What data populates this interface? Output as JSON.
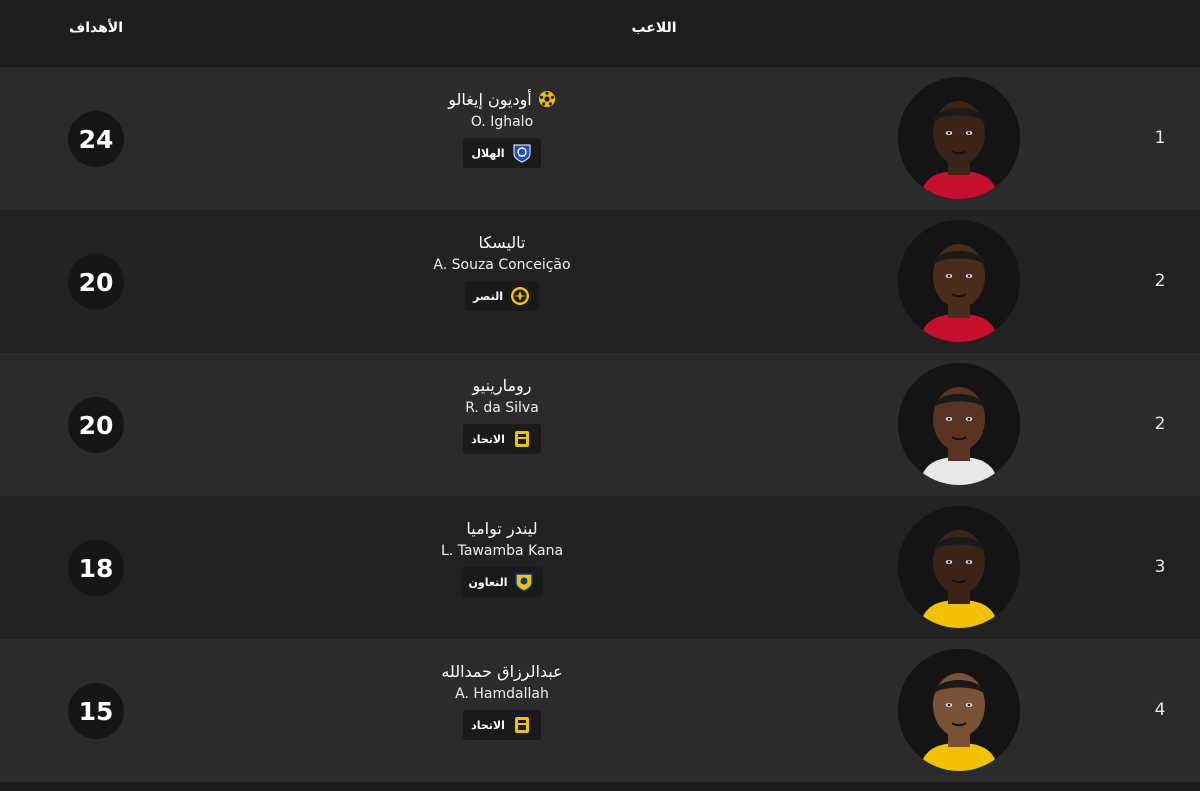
{
  "header": {
    "goals_label": "الأهداف",
    "player_label": "اللاعب"
  },
  "rows": [
    {
      "rank": "1",
      "name_ar": "أوديون إيغالو",
      "name_en": "O. Ighalo",
      "club": "الهلال",
      "club_icon": "al-hilal-logo-icon",
      "goals": "24",
      "has_ball": true,
      "kit_color": "#c8102e",
      "skin_color": "#3a2418"
    },
    {
      "rank": "2",
      "name_ar": "تاليسكا",
      "name_en": "A. Souza Conceição",
      "club": "النصر",
      "club_icon": "al-nassr-logo-icon",
      "goals": "20",
      "has_ball": false,
      "kit_color": "#c8102e",
      "skin_color": "#4a2c1c"
    },
    {
      "rank": "2",
      "name_ar": "رومارينيو",
      "name_en": "R. da Silva",
      "club": "الاتحاد",
      "club_icon": "al-ittihad-logo-icon",
      "goals": "20",
      "has_ball": false,
      "kit_color": "#e8e8e8",
      "skin_color": "#5a3422"
    },
    {
      "rank": "3",
      "name_ar": "ليندر تواميا",
      "name_en": "L. Tawamba Kana",
      "club": "التعاون",
      "club_icon": "al-taawoun-logo-icon",
      "goals": "18",
      "has_ball": false,
      "kit_color": "#f2c200",
      "skin_color": "#3a2418"
    },
    {
      "rank": "4",
      "name_ar": "عبدالرزاق حمدالله",
      "name_en": "A. Hamdallah",
      "club": "الاتحاد",
      "club_icon": "al-ittihad-logo-icon",
      "goals": "15",
      "has_ball": false,
      "kit_color": "#f2c200",
      "skin_color": "#7a5238"
    }
  ],
  "colors": {
    "row_odd": "#2b2b2b",
    "row_even": "#222222",
    "header": "#1e1e1e",
    "badge": "#161616",
    "accent_gold": "#f2c200",
    "hilal_blue": "#1c4fb4"
  }
}
